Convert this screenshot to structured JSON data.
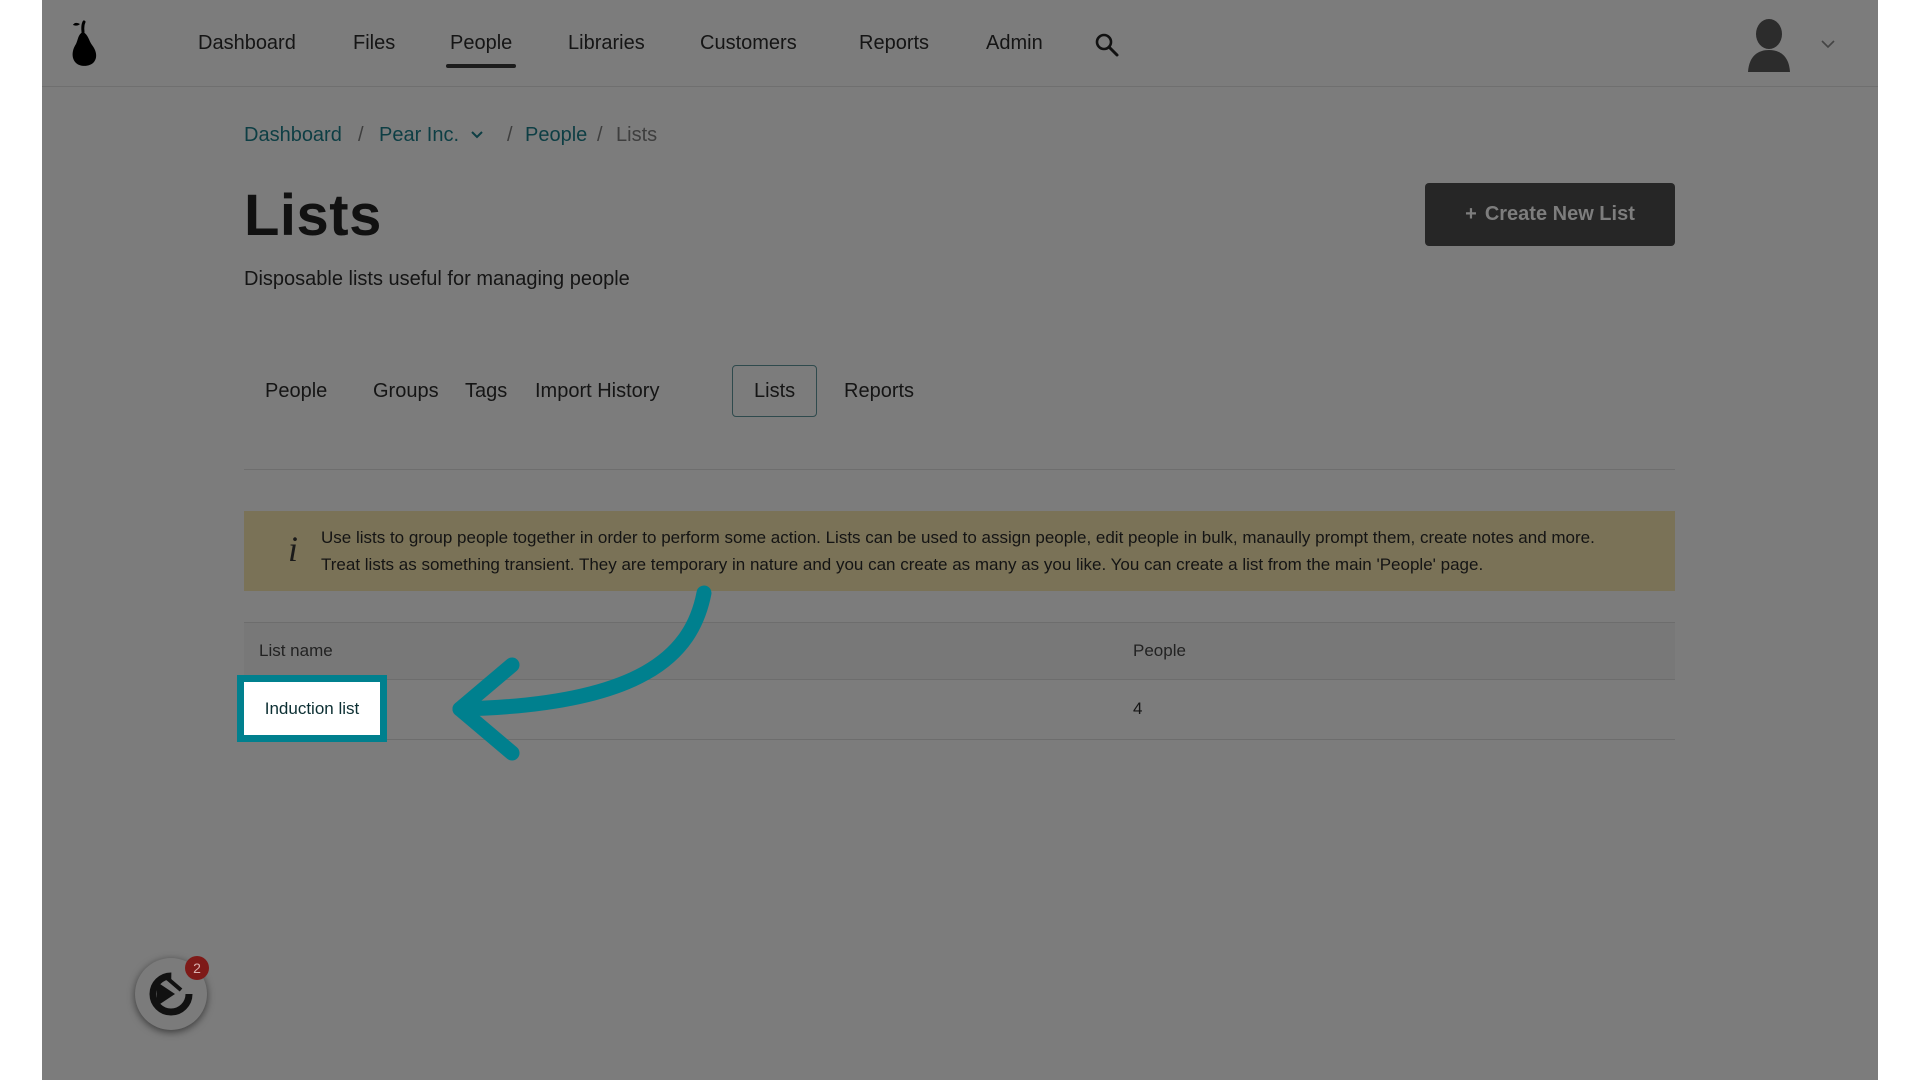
{
  "nav": {
    "items": [
      {
        "label": "Dashboard"
      },
      {
        "label": "Files"
      },
      {
        "label": "People",
        "active": true
      },
      {
        "label": "Libraries"
      },
      {
        "label": "Customers"
      },
      {
        "label": "Reports"
      },
      {
        "label": "Admin"
      }
    ],
    "icons": [
      "pear-logo-icon",
      "search-icon",
      "user-avatar-icon",
      "chevron-down-icon"
    ]
  },
  "breadcrumb": {
    "dashboard": "Dashboard",
    "sep1": "/",
    "org": "Pear Inc.",
    "sep2": "/",
    "people": "People",
    "sep3": "/",
    "current": "Lists"
  },
  "page": {
    "title": "Lists",
    "subtitle": "Disposable lists useful for managing people",
    "create_button": {
      "plus": "+",
      "label": "Create New List"
    }
  },
  "tabs": [
    {
      "label": "People"
    },
    {
      "label": "Groups"
    },
    {
      "label": "Tags"
    },
    {
      "label": "Import History"
    },
    {
      "label": "Lists",
      "active": true
    },
    {
      "label": "Reports"
    }
  ],
  "info": {
    "icon": "i",
    "line1": "Use lists to group people together in order to perform some action. Lists can be used to assign people, edit people in bulk, manaully prompt them, create notes and more.",
    "line2": "Treat lists as something transient. They are temporary in nature and you can create as many as you like. You can create a list from the main 'People' page."
  },
  "table": {
    "headers": {
      "name": "List name",
      "people": "People"
    },
    "rows": [
      {
        "name": "Induction list",
        "people": "4"
      }
    ]
  },
  "widget": {
    "badge": "2"
  },
  "colors": {
    "overlay": "#7c7c7c",
    "highlight": "#00808e",
    "button": "#262626",
    "info_bg": "#7a7257",
    "badge": "#7e1a18"
  }
}
